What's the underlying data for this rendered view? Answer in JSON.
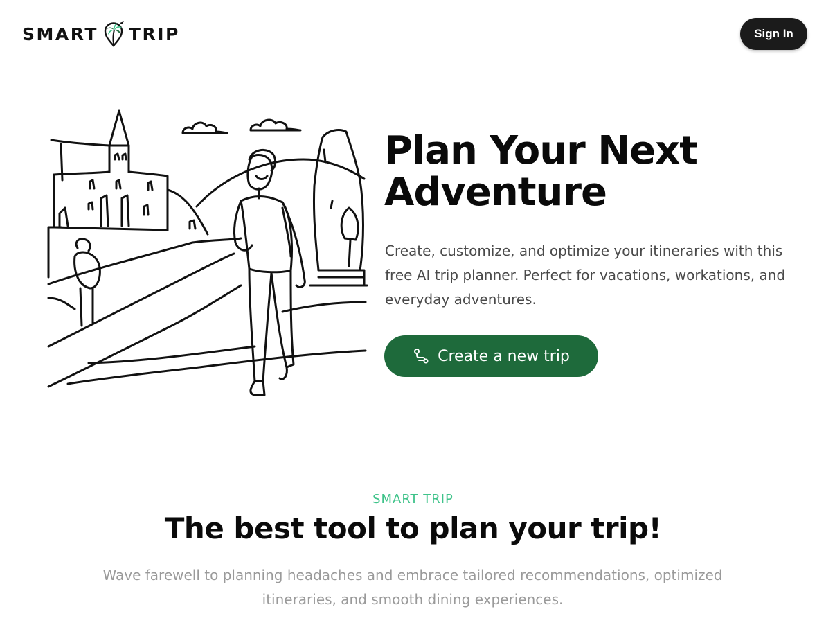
{
  "header": {
    "logo_left": "SMART",
    "logo_right": "TRIP",
    "logo_icon": "palm-tree-pin-icon",
    "sign_in_label": "Sign In"
  },
  "hero": {
    "title_line1": "Plan Your Next",
    "title_line2": "Adventure",
    "description": "Create, customize, and optimize your itineraries with this free AI trip planner. Perfect for vacations, workations, and everyday adventures.",
    "cta_label": "Create a new trip",
    "cta_icon": "route-icon",
    "illustration": "traveler-sketch-illustration"
  },
  "features": {
    "eyebrow": "SMART TRIP",
    "title": "The best tool to plan your trip!",
    "description": "Wave farewell to planning headaches and embrace tailored recommendations, optimized itineraries, and smooth dining experiences."
  },
  "colors": {
    "primary": "#1e6a3b",
    "accent": "#3fc38a",
    "dark": "#1b1b1b",
    "text_muted": "#9a9a9a"
  }
}
